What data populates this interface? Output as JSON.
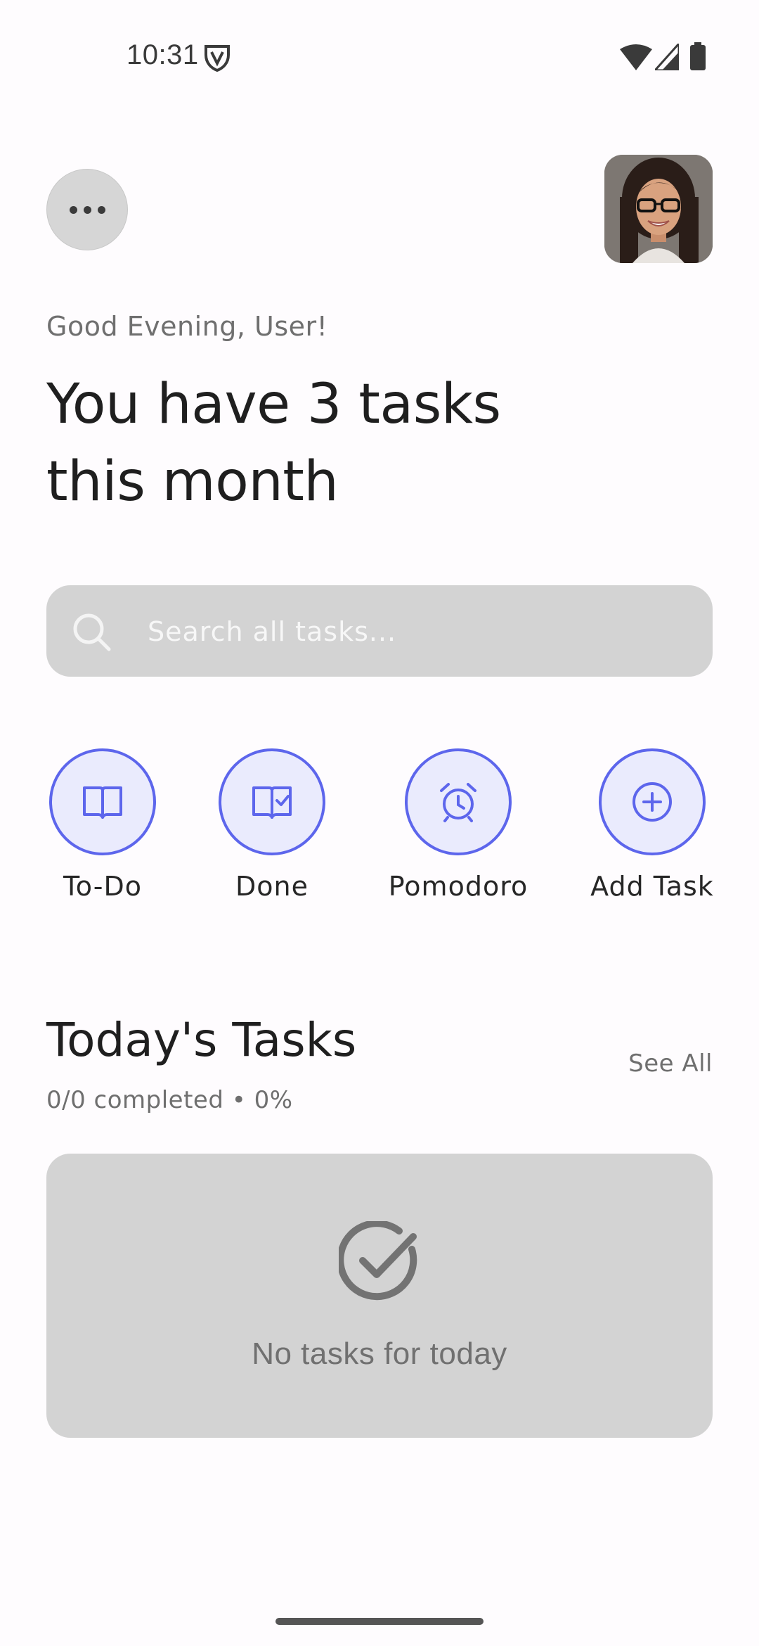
{
  "status_bar": {
    "time": "10:31"
  },
  "header": {
    "greeting": "Good Evening, User!",
    "headline_line1": "You have 3 tasks",
    "headline_line2": "this month"
  },
  "search": {
    "placeholder": "Search all tasks..."
  },
  "quick_actions": [
    {
      "label": "To-Do",
      "icon": "open-book-icon"
    },
    {
      "label": "Done",
      "icon": "book-check-icon"
    },
    {
      "label": "Pomodoro",
      "icon": "alarm-clock-icon"
    },
    {
      "label": "Add Task",
      "icon": "plus-circle-icon"
    }
  ],
  "today": {
    "title": "Today's Tasks",
    "see_all": "See All",
    "summary": "0/0 completed • 0%",
    "empty_message": "No tasks for today"
  },
  "colors": {
    "accent": "#5d66ec",
    "accent_bg": "#eaebfd",
    "card_bg": "#d3d3d3",
    "page_bg": "#fefcfe"
  }
}
